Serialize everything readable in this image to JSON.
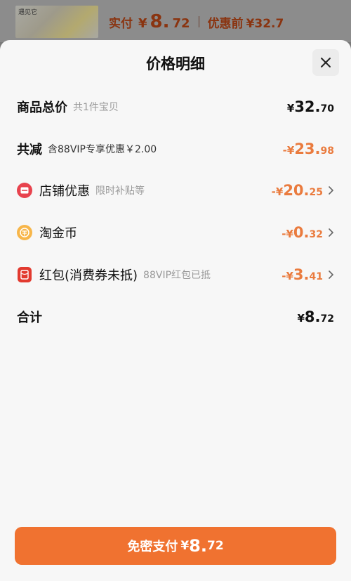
{
  "topbar": {
    "thumb_tag": "遇见它",
    "paid_label": "实付",
    "paid_yen": "¥",
    "paid_int": "8.",
    "paid_dec": "72",
    "orig_label": "优惠前",
    "orig_amount": "¥32.7"
  },
  "sheet": {
    "title": "价格明细"
  },
  "rows": {
    "total": {
      "label": "商品总价",
      "sub": "共1件宝贝",
      "yen": "¥",
      "int": "32.",
      "dec": "70"
    },
    "reduce": {
      "label": "共减",
      "sub": "含88VIP专享优惠￥2.00",
      "yen": "-¥",
      "int": "23.",
      "dec": "98"
    },
    "store": {
      "label": "店铺优惠",
      "sub": "限时补贴等",
      "yen": "-¥",
      "int": "20.",
      "dec": "25",
      "icon": "store-coupon-icon"
    },
    "coin": {
      "label": "淘金币",
      "yen": "-¥",
      "int": "0.",
      "dec": "32",
      "icon": "taojinbi-coin-icon"
    },
    "redpack": {
      "label": "红包(消费券未抵)",
      "sub": "88VIP红包已抵",
      "yen": "-¥",
      "int": "3.",
      "dec": "41",
      "icon": "red-packet-icon"
    },
    "sum": {
      "label": "合计",
      "yen": "¥",
      "int": "8.",
      "dec": "72"
    }
  },
  "pay_button": {
    "label": "免密支付",
    "yen": "¥",
    "int": "8.",
    "dec": "72"
  },
  "colors": {
    "accent": "#f07230",
    "discount": "#ea7b3e"
  }
}
